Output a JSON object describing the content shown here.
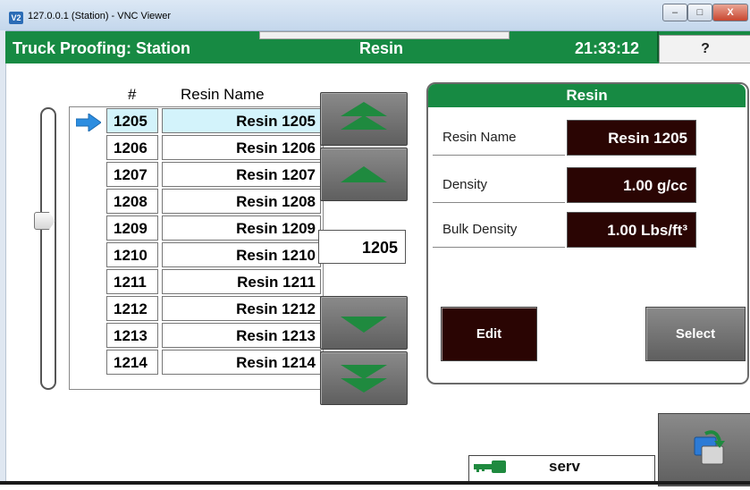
{
  "window": {
    "title": "127.0.0.1 (Station) - VNC Viewer",
    "app_icon_text": "V2",
    "minimize": "–",
    "maximize": "□",
    "close": "X"
  },
  "header": {
    "title": "Truck Proofing: Station",
    "screen": "Resin",
    "time": "21:33:12",
    "help_label": "?"
  },
  "list": {
    "col_number": "#",
    "col_name": "Resin Name",
    "selected_index": 0,
    "rows": [
      {
        "num": "1205",
        "name": "Resin 1205"
      },
      {
        "num": "1206",
        "name": "Resin 1206"
      },
      {
        "num": "1207",
        "name": "Resin 1207"
      },
      {
        "num": "1208",
        "name": "Resin 1208"
      },
      {
        "num": "1209",
        "name": "Resin 1209"
      },
      {
        "num": "1210",
        "name": "Resin 1210"
      },
      {
        "num": "1211",
        "name": "Resin 1211"
      },
      {
        "num": "1212",
        "name": "Resin 1212"
      },
      {
        "num": "1213",
        "name": "Resin 1213"
      },
      {
        "num": "1214",
        "name": "Resin 1214"
      }
    ]
  },
  "record_number": "1205",
  "panel": {
    "title": "Resin",
    "fields": [
      {
        "label": "Resin Name",
        "value": "Resin 1205"
      },
      {
        "label": "Density",
        "value": "1.00 g/cc"
      },
      {
        "label": "Bulk Density",
        "value": "1.00 Lbs/ft³"
      }
    ],
    "edit_label": "Edit",
    "select_label": "Select"
  },
  "status": {
    "user": "serv",
    "key_icon": "key-icon"
  },
  "colors": {
    "header_green": "#178a43",
    "value_bg": "#2a0503",
    "selected_row": "#d3f3fb",
    "arrow_green": "#1f8a3f"
  }
}
